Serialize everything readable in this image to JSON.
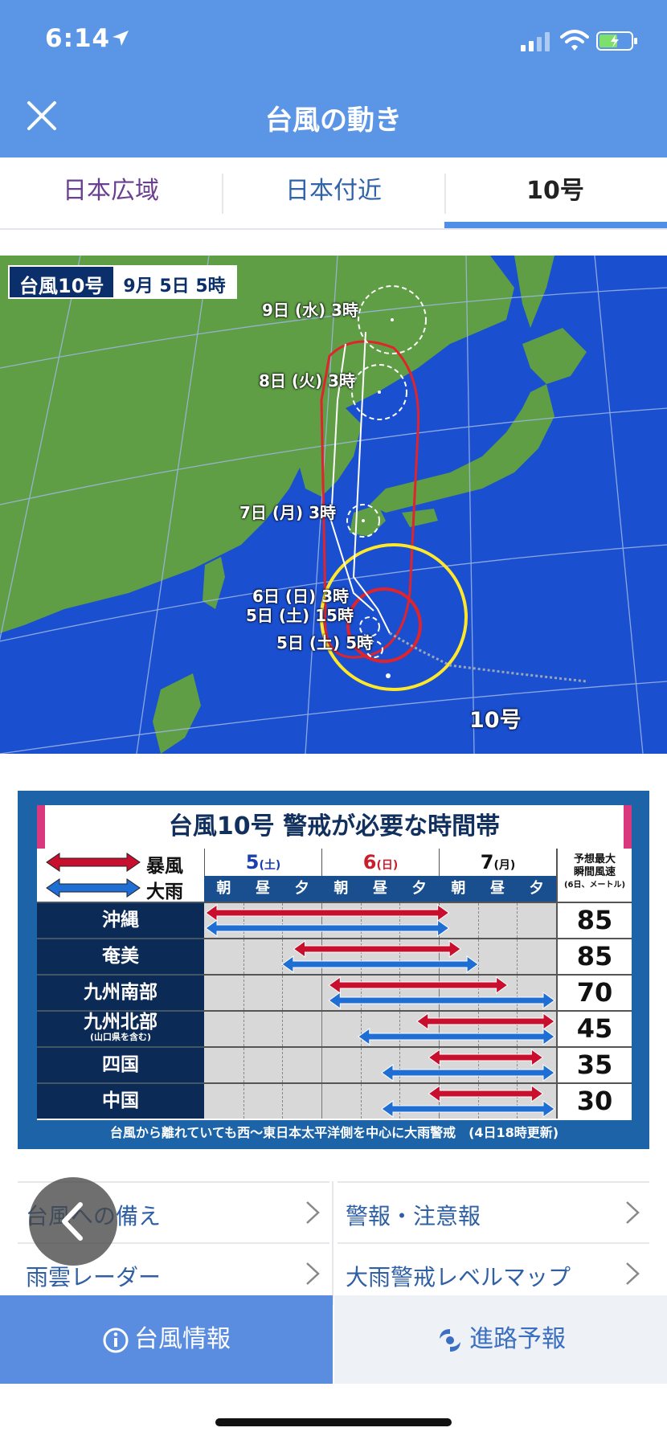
{
  "status_bar": {
    "time": "6:14"
  },
  "header": {
    "title": "台風の動き"
  },
  "tabs": [
    {
      "label": "日本広域",
      "selected": false
    },
    {
      "label": "日本付近",
      "selected": false
    },
    {
      "label": "10号",
      "selected": true
    }
  ],
  "map": {
    "badge_name": "台風10号",
    "badge_time": "9月 5日 5時",
    "labels": [
      "9日 (水) 3時",
      "8日 (火) 3時",
      "7日 (月) 3時",
      "6日 (日) 3時",
      "5日 (土) 15時",
      "5日 (土) 5時"
    ],
    "typhoon_name": "10号"
  },
  "warning": {
    "title": "台風10号 警戒が必要な時間帯",
    "legend_wind": "暴風",
    "legend_rain": "大雨",
    "days": [
      {
        "num": "5",
        "wd": "(土)"
      },
      {
        "num": "6",
        "wd": "(日)"
      },
      {
        "num": "7",
        "wd": "(月)"
      }
    ],
    "slots": [
      "朝",
      "昼",
      "夕"
    ],
    "max_header": "予想最大",
    "max_header2": "瞬間風速",
    "max_header3": "(6日、メートル)",
    "regions": [
      {
        "name": "沖縄",
        "sub": "",
        "speed": "85",
        "wind": [
          0,
          4.2
        ],
        "rain": [
          0,
          4.2
        ]
      },
      {
        "name": "奄美",
        "sub": "",
        "speed": "85",
        "wind": [
          1.5,
          4.4
        ],
        "rain": [
          1.3,
          4.7
        ]
      },
      {
        "name": "九州南部",
        "sub": "",
        "speed": "70",
        "wind": [
          2.1,
          5.2
        ],
        "rain": [
          2.1,
          6.0
        ]
      },
      {
        "name": "九州北部",
        "sub": "(山口県を含む)",
        "speed": "45",
        "wind": [
          3.6,
          6.0
        ],
        "rain": [
          2.6,
          6.0
        ]
      },
      {
        "name": "四国",
        "sub": "",
        "speed": "35",
        "wind": [
          3.8,
          5.8
        ],
        "rain": [
          3.0,
          6.0
        ]
      },
      {
        "name": "中国",
        "sub": "",
        "speed": "30",
        "wind": [
          3.8,
          5.8
        ],
        "rain": [
          3.0,
          6.0
        ]
      }
    ],
    "footer": "台風から離れていても西〜東日本太平洋側を中心に大雨警戒　(4日18時更新)"
  },
  "links": [
    {
      "label": "台風への備え"
    },
    {
      "label": "警報・注意報"
    },
    {
      "label": "雨雲レーダー"
    },
    {
      "label": "大雨警戒レベルマップ"
    }
  ],
  "bottom_tabs": [
    {
      "label": "台風情報",
      "icon": "info-icon",
      "active": true
    },
    {
      "label": "進路予報",
      "icon": "typhoon-icon",
      "active": false
    }
  ],
  "colors": {
    "accent": "#5b95e6",
    "wind": "#c8102e",
    "rain": "#1f6ed4"
  }
}
